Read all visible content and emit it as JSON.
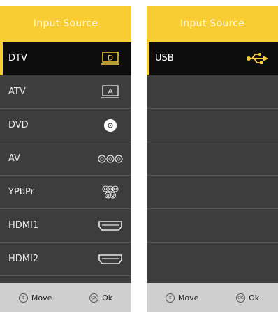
{
  "left_panel": {
    "title": "Input Source",
    "items": [
      {
        "label": "DTV",
        "icon": "dtv-icon",
        "selected": true
      },
      {
        "label": "ATV",
        "icon": "atv-icon",
        "selected": false
      },
      {
        "label": "DVD",
        "icon": "disc-icon",
        "selected": false
      },
      {
        "label": "AV",
        "icon": "av-rca-icon",
        "selected": false
      },
      {
        "label": "YPbPr",
        "icon": "component-icon",
        "selected": false
      },
      {
        "label": "HDMI1",
        "icon": "hdmi-port-icon",
        "selected": false
      },
      {
        "label": "HDMI2",
        "icon": "hdmi-port-icon",
        "selected": false
      }
    ],
    "footer": {
      "move_label": "Move",
      "ok_label": "Ok",
      "ok_glyph": "OK"
    }
  },
  "right_panel": {
    "title": "Input Source",
    "items": [
      {
        "label": "USB",
        "icon": "usb-icon",
        "selected": true
      }
    ],
    "footer": {
      "move_label": "Move",
      "ok_label": "Ok",
      "ok_glyph": "OK"
    }
  },
  "colors": {
    "accent": "#f8cd34",
    "panel_bg": "#3d3d3d",
    "selected_bg": "#0d0d0d",
    "footer_bg": "#cfcfcf"
  }
}
